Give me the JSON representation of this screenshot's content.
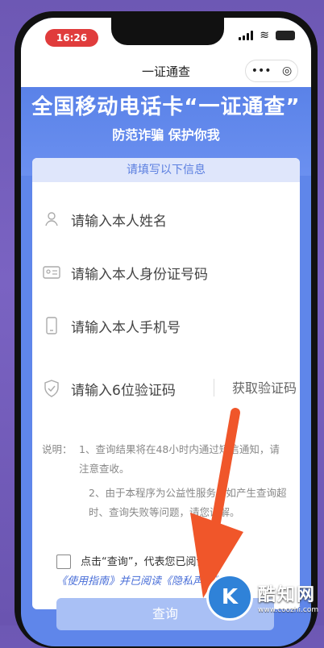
{
  "status": {
    "time": "16:26"
  },
  "nav": {
    "title": "一证通查",
    "more_icon": "•••",
    "target_icon": "◎"
  },
  "hero": {
    "title": "全国移动电话卡“一证通查”",
    "subtitle": "防范诈骗 保护你我"
  },
  "form": {
    "header": "请填写以下信息",
    "fields": [
      {
        "placeholder": "请输入本人姓名",
        "icon": "person-icon"
      },
      {
        "placeholder": "请输入本人身份证号码",
        "icon": "id-card-icon"
      },
      {
        "placeholder": "请输入本人手机号",
        "icon": "phone-icon"
      },
      {
        "placeholder": "请输入6位验证码",
        "icon": "shield-check-icon"
      }
    ],
    "get_code": "获取验证码"
  },
  "notes": {
    "label": "说明：",
    "item1": "1、查询结果将在48小时内通过短信通知，请注意查收。",
    "item2": "2、由于本程序为公益性服务，如产生查询超时、查询失败等问题，请您谅解。"
  },
  "agreement": {
    "line1": "点击“查询”，代表您已阅读过",
    "line2": "《使用指南》并已阅读《隐私声明》"
  },
  "submit": {
    "label": "查询"
  },
  "watermark": {
    "name": "酷知网",
    "url": "www.coozhi.com",
    "logo": "K"
  },
  "colors": {
    "accent": "#5b7fe0",
    "hero_bg": "#5f86ea",
    "arrow": "#f0562a"
  }
}
